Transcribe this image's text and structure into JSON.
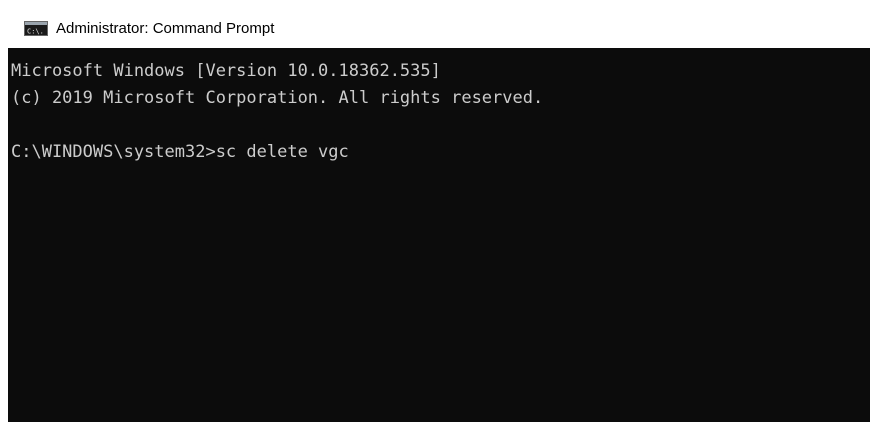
{
  "window": {
    "title": "Administrator: Command Prompt",
    "icon": "cmd-icon",
    "icon_text": "C:\\."
  },
  "console": {
    "lines": [
      "Microsoft Windows [Version 10.0.18362.535]",
      "(c) 2019 Microsoft Corporation. All rights reserved.",
      "",
      "C:\\WINDOWS\\system32>sc delete vgc"
    ]
  },
  "colors": {
    "console_background": "#0c0c0c",
    "console_text": "#cccccc",
    "titlebar_background": "#ffffff"
  }
}
